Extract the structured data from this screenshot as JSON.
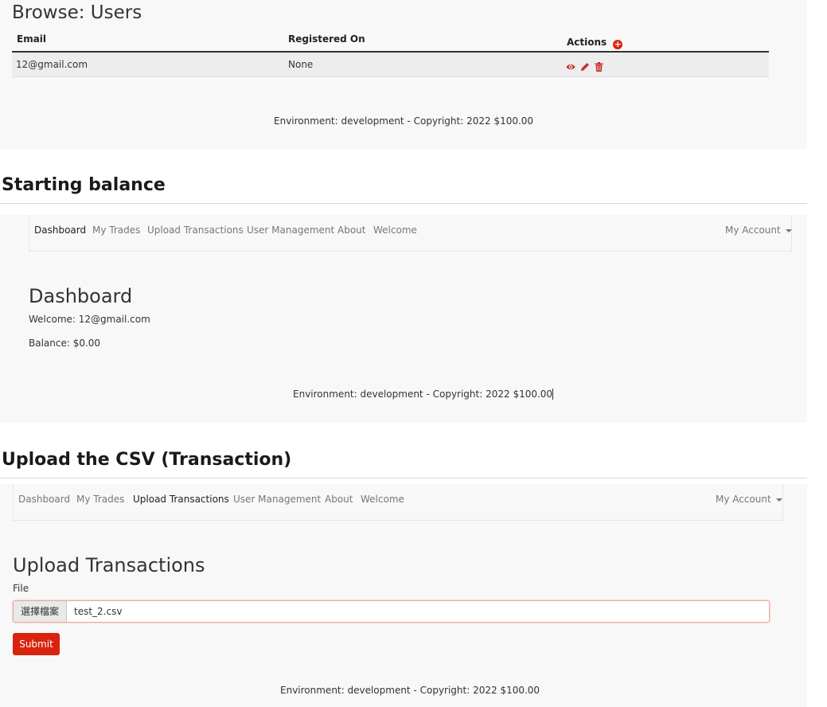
{
  "section1": {
    "title": "Browse: Users",
    "table": {
      "headers": [
        "Email",
        "Registered On",
        "Actions"
      ],
      "rows": [
        {
          "email": "12@gmail.com",
          "registered_on": "None"
        }
      ],
      "actions_icons": [
        "eye-icon",
        "pencil-icon",
        "trash-icon"
      ],
      "add_icon": "plus-circle-icon"
    },
    "footer": "Environment: development - Copyright: 2022 $100.00"
  },
  "section2": {
    "heading": "Starting balance",
    "nav": {
      "items": [
        "Dashboard",
        "My Trades",
        "Upload Transactions",
        "User Management",
        "About",
        "Welcome"
      ],
      "active": "Dashboard",
      "account": "My Account"
    },
    "page_title": "Dashboard",
    "welcome": "Welcome: 12@gmail.com",
    "balance": "Balance: $0.00",
    "footer": "Environment: development - Copyright: 2022 $100.00"
  },
  "section3": {
    "heading": "Upload the CSV (Transaction)",
    "nav": {
      "items": [
        "Dashboard",
        "My Trades",
        "Upload Transactions",
        "User Management",
        "About",
        "Welcome"
      ],
      "active": "Upload Transactions",
      "account": "My Account"
    },
    "page_title": "Upload Transactions",
    "file_label": "File",
    "choose_button": "選擇檔案",
    "file_name": "test_2.csv",
    "submit": "Submit",
    "footer": "Environment: development - Copyright: 2022 $100.00"
  },
  "colors": {
    "accent": "#d9230f",
    "icon_red": "#c9302c",
    "panel_bg": "#f8f8f8",
    "row_bg": "#ededed",
    "input_border": "#e8a7a1"
  }
}
